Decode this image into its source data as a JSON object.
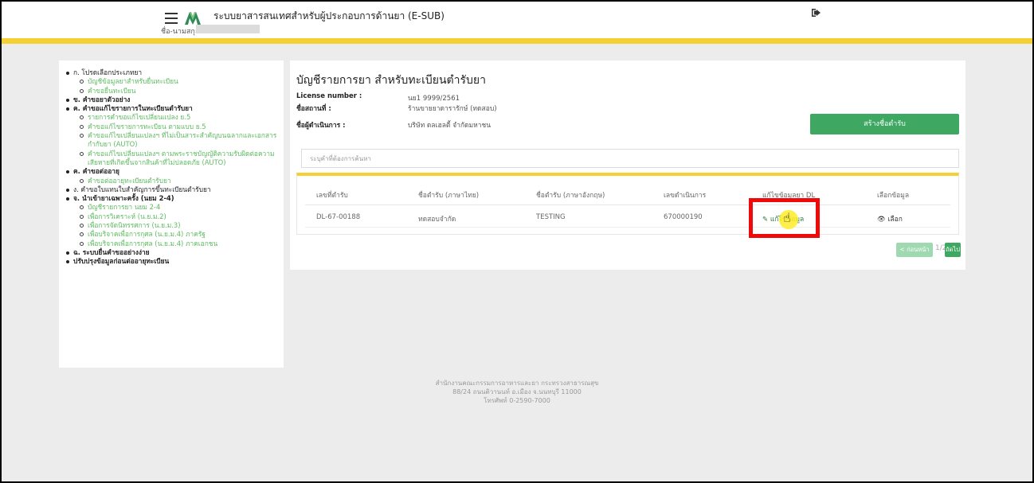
{
  "header": {
    "app_title": "ระบบยาสารสนเทศสำหรับผู้ประกอบการด้านยา (E-SUB)",
    "user_label": "ชื่อ-นามสกุล",
    "logout_icon": "logout-icon",
    "logo_icon": "fda-logo"
  },
  "sidebar": {
    "items": [
      {
        "label": "ก. โปรดเลือกประเภทยา",
        "type": "main",
        "bold": false
      },
      {
        "label": "บัญชีข้อมูลยาสำหรับยื่นทะเบียน",
        "type": "sub"
      },
      {
        "label": "คำขอยื่นทะเบียน",
        "type": "sub"
      },
      {
        "label": "ข. คำขอยาตัวอย่าง",
        "type": "main",
        "bold": true
      },
      {
        "label": "ค. คำขอแก้ไขรายการในทะเบียนตำรับยา",
        "type": "main",
        "bold": true
      },
      {
        "label": "รายการคำขอแก้ไขเปลี่ยนแปลง ย.5",
        "type": "sub"
      },
      {
        "label": "คำขอแก้ไขรายการทะเบียน ตามแบบ ย.5",
        "type": "sub"
      },
      {
        "label": "คำขอแก้ไขเปลี่ยนแปลงฯ ที่ไม่เป็นสาระสำคัญบนฉลากและเอกสารกำกับยา (AUTO)",
        "type": "sub"
      },
      {
        "label": "คำขอแก้ไขเปลี่ยนแปลงฯ ตามพระราชบัญญัติความรับผิดต่อความเสียหายที่เกิดขึ้นจากสินค้าที่ไม่ปลอดภัย (AUTO)",
        "type": "sub"
      },
      {
        "label": "ค. คำขอต่ออายุ",
        "type": "main",
        "bold": true
      },
      {
        "label": "คำขอต่ออายุทะเบียนตำรับยา",
        "type": "sub"
      },
      {
        "label": "ง. คำขอใบแทนใบสำคัญการขึ้นทะเบียนตำรับยา",
        "type": "main",
        "bold": false
      },
      {
        "label": "จ. นำเข้ายาเฉพาะครั้ง (นยม 2-4)",
        "type": "main",
        "bold": true
      },
      {
        "label": "บัญชีรายการยา นยม 2-4",
        "type": "sub"
      },
      {
        "label": "เพื่อการวิเคราะห์ (น.ย.ม.2)",
        "type": "sub"
      },
      {
        "label": "เพื่อการจัดนิทรรศการ (น.ย.ม.3)",
        "type": "sub"
      },
      {
        "label": "เพื่อบริจาคเพื่อการกุศล (น.ย.ม.4) ภาครัฐ",
        "type": "sub"
      },
      {
        "label": "เพื่อบริจาคเพื่อการกุศล (น.ย.ม.4) ภาคเอกชน",
        "type": "sub"
      },
      {
        "label": "ฉ. ระบบยื่นคำขออย่างง่าย",
        "type": "main",
        "bold": true
      },
      {
        "label": "ปรับปรุงข้อมูลก่อนต่ออายุทะเบียน",
        "type": "main",
        "bold": true
      }
    ]
  },
  "main": {
    "title": "บัญชีรายการยา สำหรับทะเบียนตำรับยา",
    "license_label": "License number :",
    "license_value": "นย1 9999/2561",
    "place_label": "ชื่อสถานที่ :",
    "place_value": "ร้านขายยาดารารักษ์ (ทดสอบ)",
    "operator_label": "ชื่อผู้ดำเนินการ :",
    "operator_value": "บริษัท ดลเฮลตี้ จำกัดมหาชน",
    "create_button": "สร้างชื่อตำรับ",
    "search_placeholder": "ระบุคำที่ต้องการค้นหา",
    "table": {
      "headers": [
        "เลขที่ตำรับ",
        "ชื่อตำรับ (ภาษาไทย)",
        "ชื่อตำรับ (ภาษาอังกฤษ)",
        "เลขดำเนินการ",
        "แก้ไขข้อมูลยา DL",
        "เลือกข้อมูล"
      ],
      "rows": [
        {
          "recipe_no": "DL-67-00188",
          "name_th": "ทดสอบจำกัด",
          "name_en": "TESTING",
          "process_no": "670000190",
          "edit_label": "แก้ไขข้อมูล",
          "select_label": "เลือก"
        }
      ]
    },
    "pagination": {
      "prev": "< ก่อนหน้า",
      "current": "1/2",
      "next": "ถัดไป >"
    }
  },
  "footer": {
    "line1": "สำนักงานคณะกรรมการอาหารและยา กระทรวงสาธารณสุข",
    "line2": "88/24 ถนนติวานนท์ อ.เมือง จ.นนทบุรี 11000",
    "line3": "โทรศัพท์ 0-2590-7000"
  },
  "colors": {
    "accent_yellow": "#f5d033",
    "primary_green": "#3ea862",
    "highlight_red": "#ee0a0a"
  }
}
